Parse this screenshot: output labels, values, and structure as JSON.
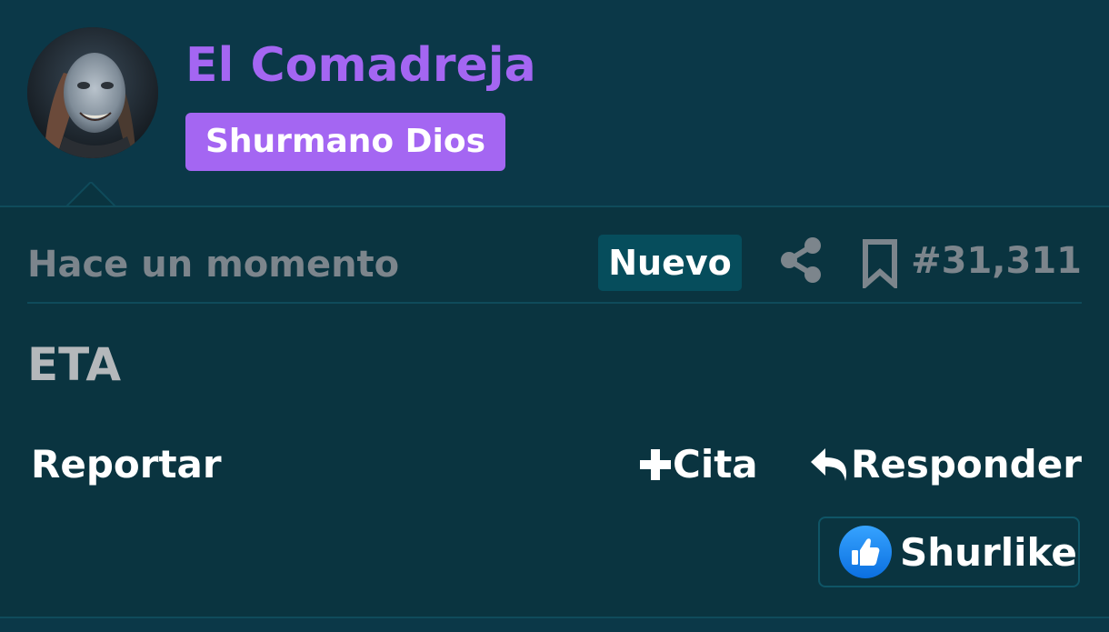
{
  "author": {
    "name": "El Comadreja",
    "rank": "Shurmano Dios"
  },
  "post": {
    "time": "Hace un momento",
    "new_badge": "Nuevo",
    "number": "#31,311",
    "content": "ETA"
  },
  "actions": {
    "report": "Reportar",
    "quote": "Cita",
    "reply": "Responder",
    "like": "Shurlike"
  },
  "icons": {
    "share": "share-icon",
    "bookmark": "bookmark-icon",
    "plus": "plus-icon",
    "reply": "reply-arrow-icon",
    "like": "thumbs-up-icon"
  },
  "colors": {
    "background": "#0b3848",
    "accent": "#a466f2",
    "muted_text": "#7c858c",
    "new_badge_bg": "#064d5c",
    "like_blue": "#1b8ff5"
  }
}
